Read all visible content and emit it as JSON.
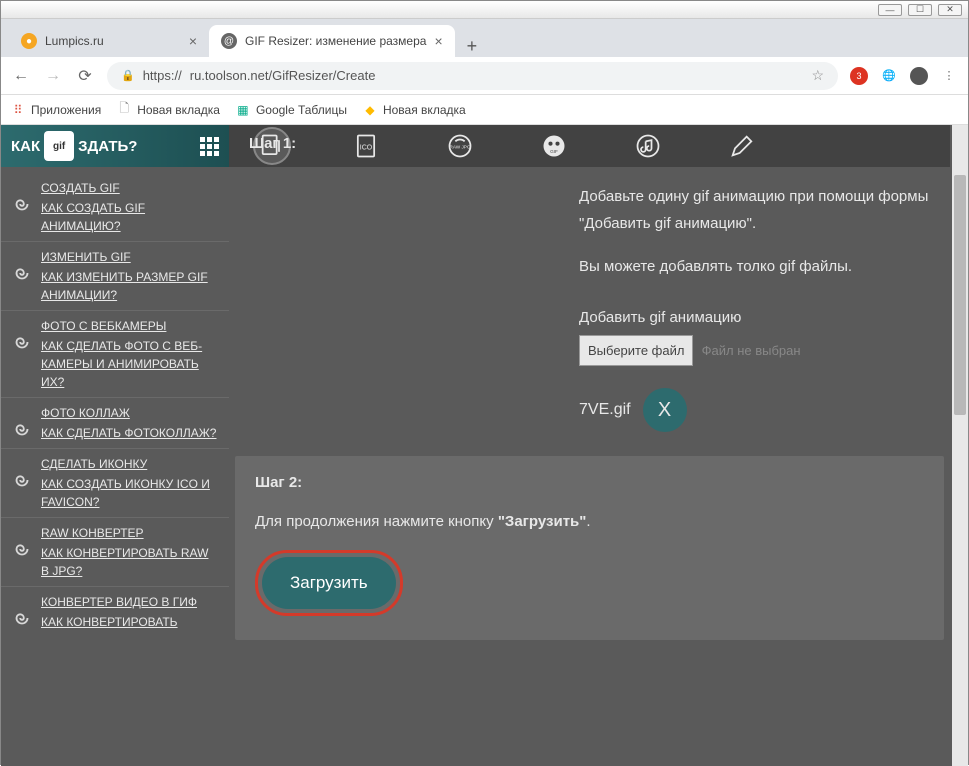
{
  "window": {
    "min": "—",
    "max": "☐",
    "close": "✕"
  },
  "tabs": [
    {
      "title": "Lumpics.ru",
      "favicon_color": "#f5a623",
      "active": false
    },
    {
      "title": "GIF Resizer: изменение размера",
      "favicon_color": "#666",
      "active": true
    }
  ],
  "toolbar": {
    "back": "←",
    "forward": "→",
    "reload": "⟳",
    "url_prefix": "https://",
    "url": "ru.toolson.net/GifResizer/Create",
    "star": "☆"
  },
  "bookmarks": [
    {
      "icon": "⠿",
      "icon_color": "#d54",
      "label": "Приложения"
    },
    {
      "icon": "🗋",
      "icon_color": "#888",
      "label": "Новая вкладка"
    },
    {
      "icon": "▦",
      "icon_color": "#0a8",
      "label": "Google Таблицы"
    },
    {
      "icon": "◆",
      "icon_color": "#fb0",
      "label": "Новая вкладка"
    }
  ],
  "sidebar": {
    "header_left": "КАК",
    "header_right": "ЗДАТЬ?",
    "items": [
      {
        "title": "СОЗДАТЬ GIF",
        "desc": "КАК СОЗДАТЬ GIF АНИМАЦИЮ?"
      },
      {
        "title": "ИЗМЕНИТЬ GIF",
        "desc": "КАК ИЗМЕНИТЬ РАЗМЕР GIF АНИМАЦИИ?"
      },
      {
        "title": "ФОТО С ВЕБКАМЕРЫ",
        "desc": "КАК СДЕЛАТЬ ФОТО С ВЕБ-КАМЕРЫ И АНИМИРОВАТЬ ИХ?"
      },
      {
        "title": "ФОТО КОЛЛАЖ",
        "desc": "КАК СДЕЛАТЬ ФОТОКОЛЛАЖ?"
      },
      {
        "title": "СДЕЛАТЬ ИКОНКУ",
        "desc": "КАК СОЗДАТЬ ИКОНКУ ICO И FAVICON?"
      },
      {
        "title": "RAW КОНВЕРТЕР",
        "desc": "КАК КОНВЕРТИРОВАТЬ RAW В JPG?"
      },
      {
        "title": "КОНВЕРТЕР ВИДЕО В ГИФ",
        "desc": "КАК КОНВЕРТИРОВАТЬ"
      }
    ]
  },
  "step1": {
    "label": "Шаг 1:",
    "instruction1": "Добавьте одину gif анимацию при помощи формы \"Добавить gif анимацию\".",
    "instruction2": "Вы можете добавлять толко gif файлы.",
    "add_label": "Добавить gif анимацию",
    "file_button": "Выберите файл",
    "file_status": "Файл не выбран",
    "filename": "7VE.gif",
    "remove": "X"
  },
  "step2": {
    "title": "Шаг 2:",
    "text_prefix": "Для продолжения нажмите кнопку ",
    "text_bold": "\"Загрузить\"",
    "text_suffix": ".",
    "button": "Загрузить"
  }
}
